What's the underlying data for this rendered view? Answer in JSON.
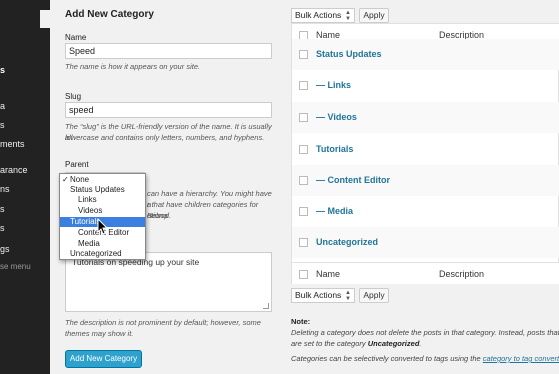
{
  "sidebar": {
    "items": [
      {
        "label": "s",
        "active": true
      },
      {
        "label": "a",
        "active": false
      },
      {
        "label": "s",
        "active": false
      },
      {
        "label": "ments",
        "active": false
      },
      {
        "label": "arance",
        "active": false
      },
      {
        "label": "ns",
        "active": false
      },
      {
        "label": "s",
        "active": false
      },
      {
        "label": "s",
        "active": false
      },
      {
        "label": "gs",
        "active": false
      },
      {
        "label": "se menu",
        "active": false
      }
    ]
  },
  "form": {
    "title": "Add New Category",
    "name_label": "Name",
    "name_value": "Speed",
    "name_hint": "The name is how it appears on your site.",
    "slug_label": "Slug",
    "slug_value": "speed",
    "slug_hint_1": "The “slug” is the URL-friendly version of the name. It is usually all",
    "slug_hint_2": "lowercase and contains only letters, numbers, and hyphens.",
    "parent_label": "Parent",
    "parent_hint_1": "can have a hierarchy. You might have a",
    "parent_hint_2": "r that have children categories for Bebop",
    "parent_hint_3": "otional.",
    "description_value": "Tutorials on speeding up your site",
    "description_hint_1": "The description is not prominent by default; however, some",
    "description_hint_2": "themes may show it.",
    "submit_label": "Add New Category"
  },
  "dropdown": {
    "check_mark": "✓",
    "options": [
      {
        "label": "None",
        "indent": 0,
        "checked": true,
        "selected": false
      },
      {
        "label": "Status Updates",
        "indent": 0,
        "checked": false,
        "selected": false
      },
      {
        "label": "Links",
        "indent": 1,
        "checked": false,
        "selected": false
      },
      {
        "label": "Videos",
        "indent": 1,
        "checked": false,
        "selected": false
      },
      {
        "label": "Tutorials",
        "indent": 0,
        "checked": false,
        "selected": true
      },
      {
        "label": "Content Editor",
        "indent": 1,
        "checked": false,
        "selected": false
      },
      {
        "label": "Media",
        "indent": 1,
        "checked": false,
        "selected": false
      },
      {
        "label": "Uncategorized",
        "indent": 0,
        "checked": false,
        "selected": false
      }
    ]
  },
  "list": {
    "bulk_actions": "Bulk Actions",
    "apply": "Apply",
    "col_name": "Name",
    "col_description": "Description",
    "rows": [
      {
        "name": "Status Updates"
      },
      {
        "name": "— Links"
      },
      {
        "name": "— Videos"
      },
      {
        "name": "Tutorials"
      },
      {
        "name": "— Content Editor"
      },
      {
        "name": "— Media"
      },
      {
        "name": "Uncategorized"
      }
    ],
    "note_title": "Note:",
    "note_1": "Deleting a category does not delete the posts in that category. Instead, posts that",
    "note_2_prefix": "are set to the category ",
    "note_2_bold": "Uncategorized",
    "note_2_suffix": ".",
    "note_3_prefix": "Categories can be selectively converted to tags using the ",
    "note_3_link": "category to tag converter"
  },
  "colors": {
    "sidebar_bg": "#222222",
    "primary_button": "#2ea2cc",
    "link": "#21759b",
    "dropdown_highlight": "#3b7fe0"
  }
}
